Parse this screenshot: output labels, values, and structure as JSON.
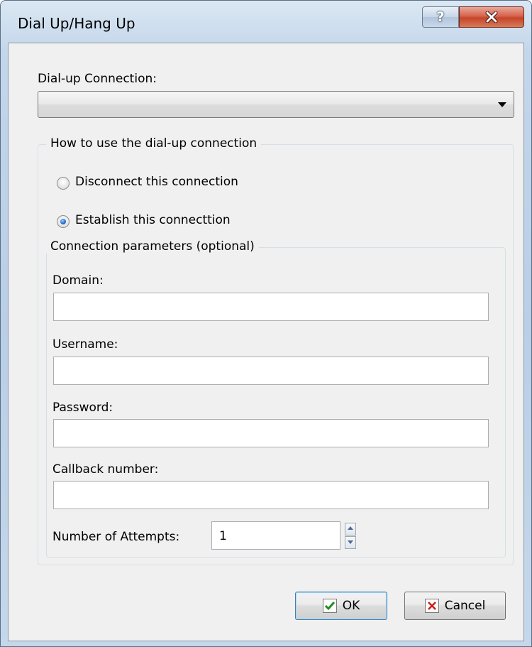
{
  "window": {
    "title": "Dial Up/Hang Up",
    "help_glyph": "?",
    "close_glyph": "x"
  },
  "dialup": {
    "label": "Dial-up Connection:",
    "selected_value": ""
  },
  "usage_group": {
    "legend": "How to use the dial-up connection",
    "options": [
      {
        "label": "Disconnect this connection",
        "selected": false
      },
      {
        "label": "Establish this connecttion",
        "selected": true
      }
    ]
  },
  "params_group": {
    "legend": "Connection parameters (optional)",
    "domain_label": "Domain:",
    "domain_value": "",
    "username_label": "Username:",
    "username_value": "",
    "password_label": "Password:",
    "password_value": "",
    "callback_label": "Callback number:",
    "callback_value": "",
    "attempts_label": "Number of Attempts:",
    "attempts_value": "1"
  },
  "buttons": {
    "ok_label": "OK",
    "cancel_label": "Cancel"
  },
  "icons": {
    "ok": "checkmark-icon",
    "cancel": "x-icon"
  },
  "colors": {
    "ok_check": "#1e8c1e",
    "cancel_x": "#d11a1a",
    "default_button_border": "#3c7fb1"
  }
}
